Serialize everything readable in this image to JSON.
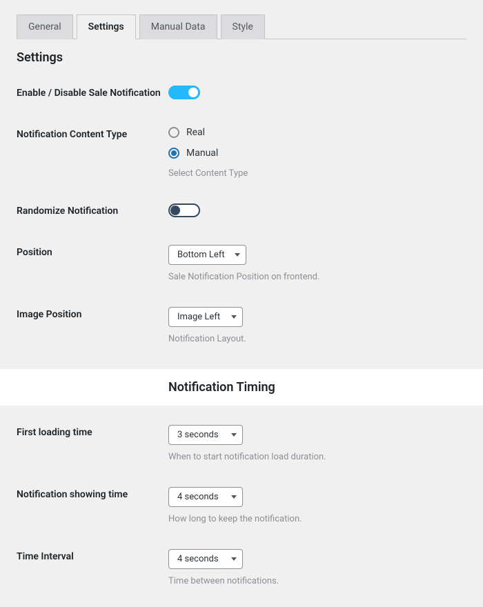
{
  "tabs": {
    "general": "General",
    "settings": "Settings",
    "manual_data": "Manual Data",
    "style": "Style"
  },
  "page_title": "Settings",
  "fields": {
    "enable": {
      "label": "Enable / Disable Sale Notification",
      "value": true
    },
    "content_type": {
      "label": "Notification Content Type",
      "options": {
        "real": "Real",
        "manual": "Manual"
      },
      "selected": "manual",
      "helper": "Select Content Type"
    },
    "randomize": {
      "label": "Randomize Notification",
      "value": false
    },
    "position": {
      "label": "Position",
      "selected": "Bottom Left",
      "helper": "Sale Notification Position on frontend."
    },
    "image_position": {
      "label": "Image Position",
      "selected": "Image Left",
      "helper": "Notification Layout."
    }
  },
  "timing_section_title": "Notification Timing",
  "timing": {
    "first_loading": {
      "label": "First loading time",
      "selected": "3 seconds",
      "helper": "When to start notification load duration."
    },
    "showing": {
      "label": "Notification showing time",
      "selected": "4 seconds",
      "helper": "How long to keep the notification."
    },
    "interval": {
      "label": "Time Interval",
      "selected": "4 seconds",
      "helper": "Time between notifications."
    }
  }
}
